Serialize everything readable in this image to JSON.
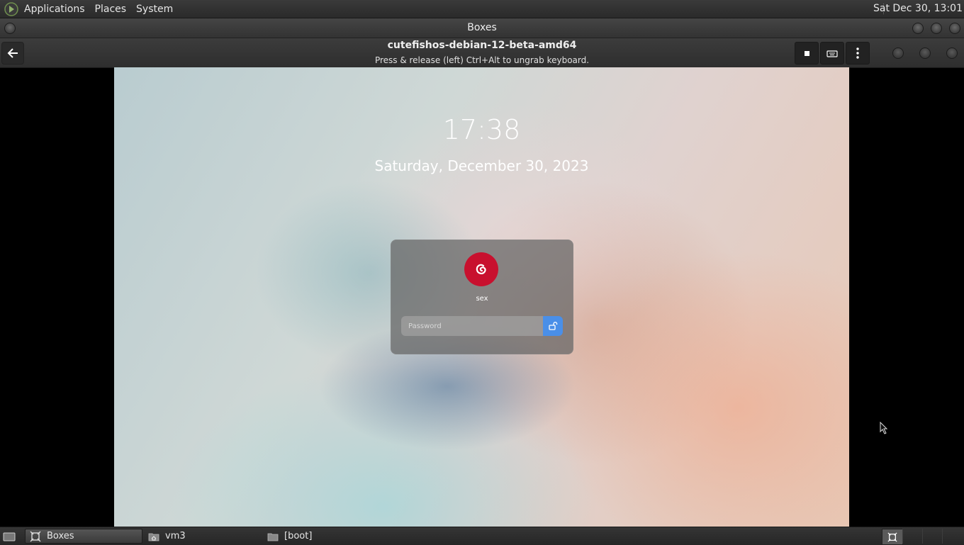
{
  "top_panel": {
    "menus": [
      "Applications",
      "Places",
      "System"
    ],
    "clock": "Sat Dec 30, 13:01"
  },
  "window": {
    "title": "Boxes"
  },
  "header": {
    "vm_name": "cutefishos-debian-12-beta-amd64",
    "hint": "Press & release (left) Ctrl+Alt to ungrab keyboard."
  },
  "vm_screen": {
    "time": "17:38",
    "date": "Saturday, December 30, 2023",
    "username": "sex",
    "password_placeholder": "Password",
    "accent_color": "#4a8fe8",
    "avatar_color": "#c8102e"
  },
  "taskbar": {
    "tasks": [
      {
        "label": "Boxes",
        "icon": "boxes-icon",
        "active": true
      },
      {
        "label": "vm3",
        "icon": "folder-home-icon",
        "active": false
      },
      {
        "label": "[boot]",
        "icon": "folder-icon",
        "active": false
      }
    ]
  }
}
